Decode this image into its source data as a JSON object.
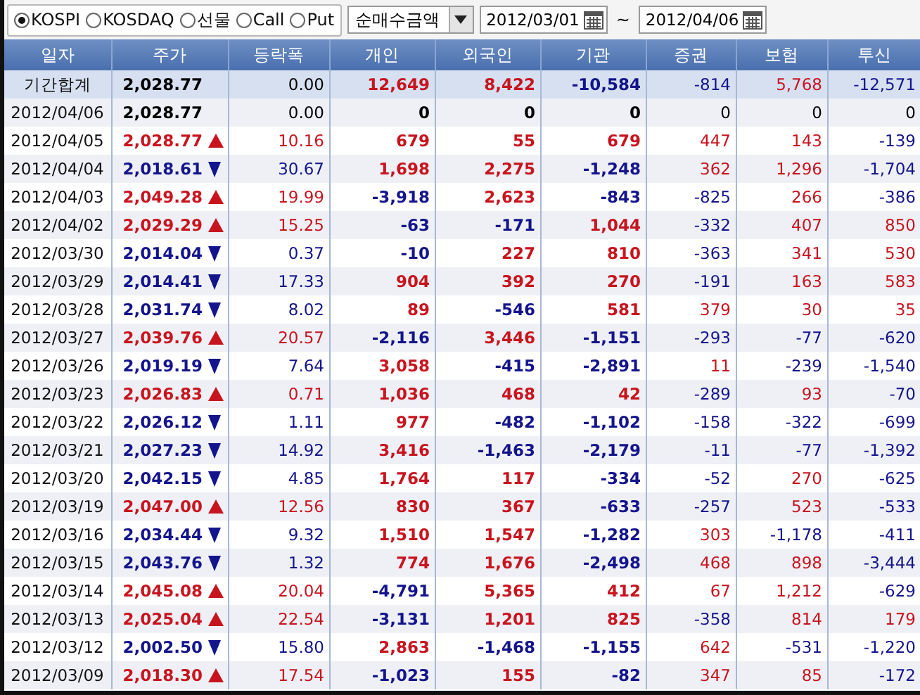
{
  "toolbar": {
    "markets": [
      {
        "label": "KOSPI",
        "selected": true
      },
      {
        "label": "KOSDAQ",
        "selected": false
      },
      {
        "label": "선물",
        "selected": false
      },
      {
        "label": "Call",
        "selected": false
      },
      {
        "label": "Put",
        "selected": false
      }
    ],
    "measure": "순매수금액",
    "date_from": "2012/03/01",
    "separator": "~",
    "date_to": "2012/04/06"
  },
  "table": {
    "columns": [
      "일자",
      "주가",
      "등락폭",
      "개인",
      "외국인",
      "기관",
      "증권",
      "보험",
      "투신"
    ],
    "rows": [
      {
        "kind": "summary",
        "date": "기간합계",
        "price": "2,028.77",
        "up": false,
        "down": false,
        "change": "0.00",
        "values": [
          "12,649",
          "8,422",
          "-10,584",
          "-814",
          "5,768",
          "-12,571"
        ]
      },
      {
        "kind": "day",
        "date": "2012/04/06",
        "price": "2,028.77",
        "up": false,
        "down": false,
        "change": "0.00",
        "values": [
          "0",
          "0",
          "0",
          "0",
          "0",
          "0"
        ]
      },
      {
        "kind": "day",
        "date": "2012/04/05",
        "price": "2,028.77",
        "up": true,
        "down": false,
        "change": "10.16",
        "values": [
          "679",
          "55",
          "679",
          "447",
          "143",
          "-139"
        ]
      },
      {
        "kind": "day",
        "date": "2012/04/04",
        "price": "2,018.61",
        "up": false,
        "down": true,
        "change": "30.67",
        "values": [
          "1,698",
          "2,275",
          "-1,248",
          "362",
          "1,296",
          "-1,704"
        ]
      },
      {
        "kind": "day",
        "date": "2012/04/03",
        "price": "2,049.28",
        "up": true,
        "down": false,
        "change": "19.99",
        "values": [
          "-3,918",
          "2,623",
          "-843",
          "-825",
          "266",
          "-386"
        ]
      },
      {
        "kind": "day",
        "date": "2012/04/02",
        "price": "2,029.29",
        "up": true,
        "down": false,
        "change": "15.25",
        "values": [
          "-63",
          "-171",
          "1,044",
          "-332",
          "407",
          "850"
        ]
      },
      {
        "kind": "day",
        "date": "2012/03/30",
        "price": "2,014.04",
        "up": false,
        "down": true,
        "change": "0.37",
        "values": [
          "-10",
          "227",
          "810",
          "-363",
          "341",
          "530"
        ]
      },
      {
        "kind": "day",
        "date": "2012/03/29",
        "price": "2,014.41",
        "up": false,
        "down": true,
        "change": "17.33",
        "values": [
          "904",
          "392",
          "270",
          "-191",
          "163",
          "583"
        ]
      },
      {
        "kind": "day",
        "date": "2012/03/28",
        "price": "2,031.74",
        "up": false,
        "down": true,
        "change": "8.02",
        "values": [
          "89",
          "-546",
          "581",
          "379",
          "30",
          "35"
        ]
      },
      {
        "kind": "day",
        "date": "2012/03/27",
        "price": "2,039.76",
        "up": true,
        "down": false,
        "change": "20.57",
        "values": [
          "-2,116",
          "3,446",
          "-1,151",
          "-293",
          "-77",
          "-620"
        ]
      },
      {
        "kind": "day",
        "date": "2012/03/26",
        "price": "2,019.19",
        "up": false,
        "down": true,
        "change": "7.64",
        "values": [
          "3,058",
          "-415",
          "-2,891",
          "11",
          "-239",
          "-1,540"
        ]
      },
      {
        "kind": "day",
        "date": "2012/03/23",
        "price": "2,026.83",
        "up": true,
        "down": false,
        "change": "0.71",
        "values": [
          "1,036",
          "468",
          "42",
          "-289",
          "93",
          "-70"
        ]
      },
      {
        "kind": "day",
        "date": "2012/03/22",
        "price": "2,026.12",
        "up": false,
        "down": true,
        "change": "1.11",
        "values": [
          "977",
          "-482",
          "-1,102",
          "-158",
          "-322",
          "-699"
        ]
      },
      {
        "kind": "day",
        "date": "2012/03/21",
        "price": "2,027.23",
        "up": false,
        "down": true,
        "change": "14.92",
        "values": [
          "3,416",
          "-1,463",
          "-2,179",
          "-11",
          "-77",
          "-1,392"
        ]
      },
      {
        "kind": "day",
        "date": "2012/03/20",
        "price": "2,042.15",
        "up": false,
        "down": true,
        "change": "4.85",
        "values": [
          "1,764",
          "117",
          "-334",
          "-52",
          "270",
          "-625"
        ]
      },
      {
        "kind": "day",
        "date": "2012/03/19",
        "price": "2,047.00",
        "up": true,
        "down": false,
        "change": "12.56",
        "values": [
          "830",
          "367",
          "-633",
          "-257",
          "523",
          "-533"
        ]
      },
      {
        "kind": "day",
        "date": "2012/03/16",
        "price": "2,034.44",
        "up": false,
        "down": true,
        "change": "9.32",
        "values": [
          "1,510",
          "1,547",
          "-1,282",
          "303",
          "-1,178",
          "-411"
        ]
      },
      {
        "kind": "day",
        "date": "2012/03/15",
        "price": "2,043.76",
        "up": false,
        "down": true,
        "change": "1.32",
        "values": [
          "774",
          "1,676",
          "-2,498",
          "468",
          "898",
          "-3,444"
        ]
      },
      {
        "kind": "day",
        "date": "2012/03/14",
        "price": "2,045.08",
        "up": true,
        "down": false,
        "change": "20.04",
        "values": [
          "-4,791",
          "5,365",
          "412",
          "67",
          "1,212",
          "-629"
        ]
      },
      {
        "kind": "day",
        "date": "2012/03/13",
        "price": "2,025.04",
        "up": true,
        "down": false,
        "change": "22.54",
        "values": [
          "-3,131",
          "1,201",
          "825",
          "-358",
          "814",
          "179"
        ]
      },
      {
        "kind": "day",
        "date": "2012/03/12",
        "price": "2,002.50",
        "up": false,
        "down": true,
        "change": "15.80",
        "values": [
          "2,863",
          "-1,468",
          "-1,155",
          "642",
          "-531",
          "-1,220"
        ]
      },
      {
        "kind": "day",
        "date": "2012/03/09",
        "price": "2,018.30",
        "up": true,
        "down": false,
        "change": "17.54",
        "values": [
          "-1,023",
          "155",
          "-82",
          "347",
          "85",
          "-172"
        ]
      }
    ]
  }
}
